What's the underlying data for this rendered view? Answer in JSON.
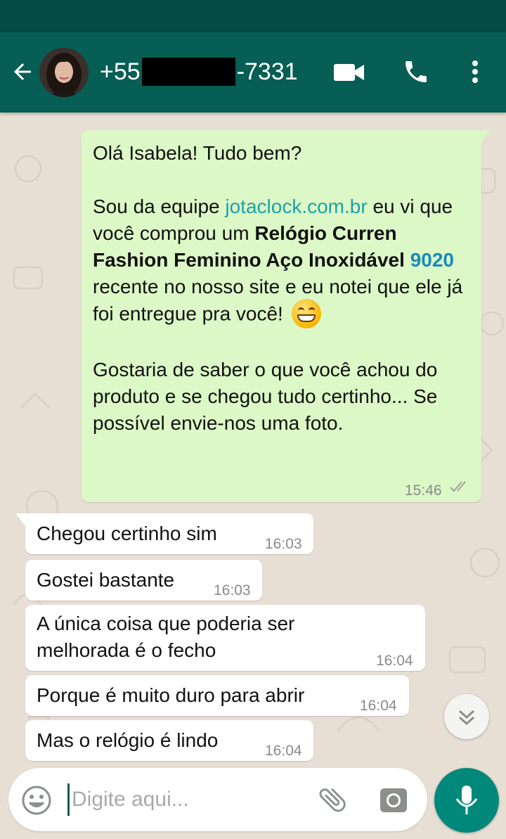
{
  "header": {
    "contact_prefix": "+55",
    "contact_suffix": "-7331",
    "icons": {
      "back": "arrow-left-icon",
      "video": "video-camera-icon",
      "call": "phone-icon",
      "menu": "more-vertical-icon"
    }
  },
  "messages": {
    "outgoing": {
      "greeting": "Olá Isabela! Tudo bem?",
      "p2_intro": "Sou da equipe ",
      "p2_link": "jotaclock.com.br",
      "p2_after_link": " eu vi que você comprou um ",
      "p2_product": "Relógio Curren Fashion Feminino Aço Inoxidável",
      "p2_space": " ",
      "p2_model": "9020",
      "p2_rest": " recente no nosso site e eu notei que ele já foi entregue pra você!",
      "p3": "Gostaria de saber o que você achou do produto e se chegou tudo certinho... Se possível envie-nos uma foto.",
      "time": "15:46",
      "status": "read-double-check"
    },
    "incoming": [
      {
        "text": "Chegou certinho sim",
        "time": "16:03"
      },
      {
        "text": "Gostei bastante",
        "time": "16:03"
      },
      {
        "text": "A única coisa que poderia ser melhorada é o fecho",
        "time": "16:04"
      },
      {
        "text": "Porque é muito duro para abrir",
        "time": "16:04"
      },
      {
        "text": "Mas o relógio é lindo",
        "time": "16:04"
      }
    ]
  },
  "input": {
    "placeholder": "Digite aqui...",
    "value": ""
  },
  "colors": {
    "header": "#075e54",
    "status_bar": "#054d44",
    "outgoing_bubble": "#dcf8c6",
    "incoming_bubble": "#ffffff",
    "chat_background": "#e7ded4",
    "fab": "#00897b",
    "link": "#1da2a8"
  }
}
